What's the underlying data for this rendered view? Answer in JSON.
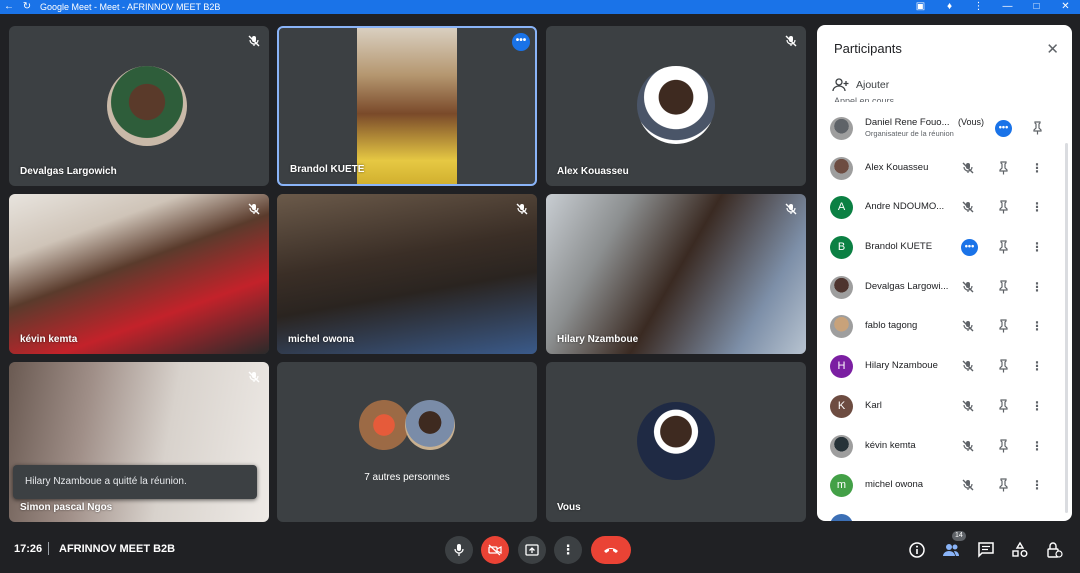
{
  "titlebar": {
    "title": "Google Meet - Meet - AFRINNOV MEET B2B",
    "back_icon": "arrow-left-icon",
    "reload_icon": "reload-icon",
    "right_icons": [
      "camera-icon",
      "extension-icon",
      "kebab-icon",
      "minimize-icon",
      "maximize-icon",
      "close-icon"
    ]
  },
  "tiles": [
    {
      "name": "Devalgas Largowich",
      "muted": true
    },
    {
      "name": "Brandol KUETE",
      "active": true
    },
    {
      "name": "Alex Kouasseu",
      "muted": true
    },
    {
      "name": "kévin kemta",
      "muted": true
    },
    {
      "name": "michel owona",
      "muted": true
    },
    {
      "name": "Hilary Nzamboue",
      "muted": true
    },
    {
      "name": "Simon pascal Ngos",
      "muted": true
    },
    {
      "name": "7 autres personnes"
    },
    {
      "name": "Vous"
    }
  ],
  "toast": {
    "text": "Hilary Nzamboue a quitté la réunion."
  },
  "participants": {
    "title": "Participants",
    "add_label": "Ajouter",
    "section_label": "Appel en cours",
    "you_label": "(Vous)",
    "items": [
      {
        "name": "Daniel Rene Fouo...",
        "role": "Organisateur de la réunion",
        "avatar": "photo",
        "color": "#5f6368"
      },
      {
        "name": "Alex Kouasseu",
        "avatar": "photo",
        "color": "#6d4c41"
      },
      {
        "name": "Andre NDOUMO...",
        "avatar": "A",
        "color": "#0b8043"
      },
      {
        "name": "Brandol KUETE",
        "avatar": "B",
        "color": "#0b8043"
      },
      {
        "name": "Devalgas Largowi...",
        "avatar": "photo",
        "color": "#4e342e"
      },
      {
        "name": "fablo tagong",
        "avatar": "photo",
        "color": "#c8a27a"
      },
      {
        "name": "Hilary Nzamboue",
        "avatar": "H",
        "color": "#7b1fa2"
      },
      {
        "name": "Karl",
        "avatar": "K",
        "color": "#6d4c41"
      },
      {
        "name": "kévin kemta",
        "avatar": "photo",
        "color": "#263238"
      },
      {
        "name": "michel owona",
        "avatar": "m",
        "color": "#43a047"
      }
    ]
  },
  "bottom": {
    "time": "17:26",
    "meeting": "AFRINNOV MEET B2B",
    "participant_count": "14"
  }
}
